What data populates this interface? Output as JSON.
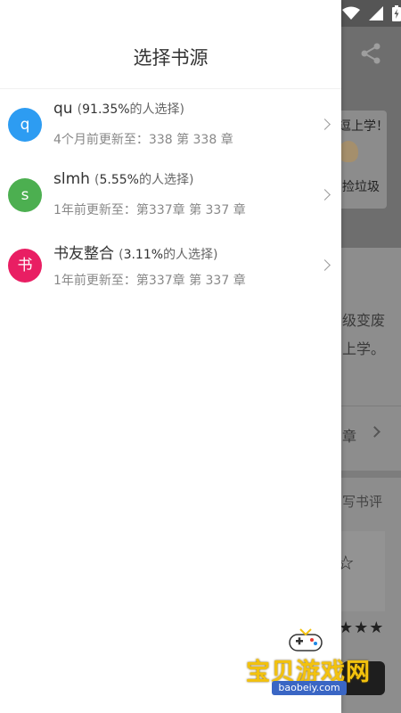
{
  "drawer": {
    "title": "选择书源",
    "sources": [
      {
        "avatar": "q",
        "color": "#2d9cf2",
        "name": "qu",
        "pct_open": "(",
        "pct": "91.35%",
        "pct_close": "的人选择)",
        "update": "4个月前更新至：338 第 338 章"
      },
      {
        "avatar": "s",
        "color": "#4caf50",
        "name": "slmh",
        "pct_open": "(",
        "pct": "5.55%",
        "pct_close": "的人选择)",
        "update": "1年前更新至：第337章 第 337 章"
      },
      {
        "avatar": "书",
        "color": "#e91e63",
        "name": "书友整合",
        "pct_open": "(",
        "pct": "3.11%",
        "pct_close": "的人选择)",
        "update": "1年前更新至：第337章 第 337 章"
      }
    ]
  },
  "background": {
    "cover_text_top": "逗上学！",
    "cover_text_bottom": "捡垃圾",
    "desc_line1": "级变废",
    "desc_line2": "上学。",
    "chapter_fragment": "章",
    "review_fragment": "写书评",
    "star_outline": "☆",
    "stars": "★★★"
  },
  "watermark": {
    "text": "宝贝游戏网",
    "url": "baobeiy.com"
  },
  "icons": {
    "share": "share-icon",
    "wifi": "wifi-icon",
    "signal": "signal-icon",
    "battery": "battery-icon"
  }
}
